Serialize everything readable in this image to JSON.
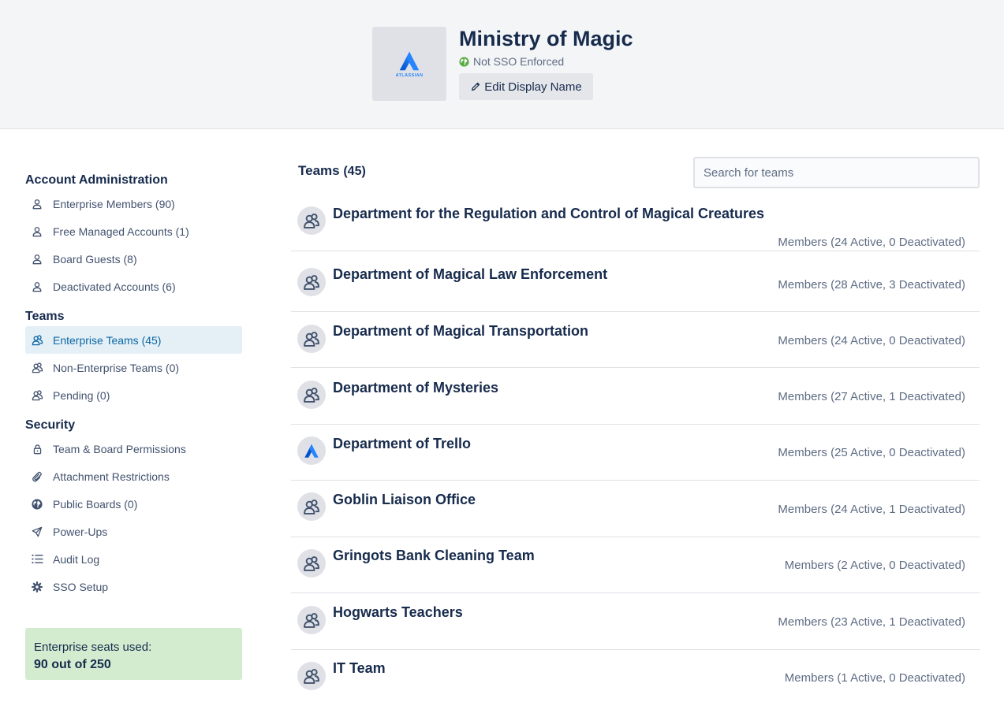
{
  "org": {
    "logo_wordmark": "ATLASSIAN",
    "name": "Ministry of Magic",
    "sso_status": "Not SSO Enforced",
    "edit_label": "Edit Display Name"
  },
  "sidebar": {
    "sections": [
      {
        "heading": "Account Administration",
        "items": [
          {
            "label": "Enterprise Members (90)",
            "icon": "person-icon"
          },
          {
            "label": "Free Managed Accounts (1)",
            "icon": "person-icon"
          },
          {
            "label": "Board Guests (8)",
            "icon": "person-icon"
          },
          {
            "label": "Deactivated Accounts (6)",
            "icon": "person-icon"
          }
        ]
      },
      {
        "heading": "Teams",
        "items": [
          {
            "label": "Enterprise Teams (45)",
            "icon": "team-icon",
            "active": true
          },
          {
            "label": "Non-Enterprise Teams (0)",
            "icon": "team-icon"
          },
          {
            "label": "Pending (0)",
            "icon": "team-icon"
          }
        ]
      },
      {
        "heading": "Security",
        "items": [
          {
            "label": "Team & Board Permissions",
            "icon": "lock-icon"
          },
          {
            "label": "Attachment Restrictions",
            "icon": "paperclip-icon"
          },
          {
            "label": "Public Boards (0)",
            "icon": "globe-icon"
          },
          {
            "label": "Power-Ups",
            "icon": "rocket-icon"
          },
          {
            "label": "Audit Log",
            "icon": "list-icon"
          },
          {
            "label": "SSO Setup",
            "icon": "gear-icon"
          }
        ]
      }
    ],
    "seats_label": "Enterprise seats used:",
    "seats_value": "90 out of 250"
  },
  "main": {
    "title": "Teams",
    "count": "(45)",
    "search_placeholder": "Search for teams",
    "teams": [
      {
        "name": "Department for the Regulation and Control of Magical Creatures",
        "members": "Members (24 Active, 0 Deactivated)",
        "avatar": "team-icon"
      },
      {
        "name": "Department of Magical Law Enforcement",
        "members": "Members (28 Active, 3 Deactivated)",
        "avatar": "team-icon"
      },
      {
        "name": "Department of Magical Transportation",
        "members": "Members (24 Active, 0 Deactivated)",
        "avatar": "team-icon"
      },
      {
        "name": "Department of Mysteries",
        "members": "Members (27 Active, 1 Deactivated)",
        "avatar": "team-icon"
      },
      {
        "name": "Department of Trello",
        "members": "Members (25 Active, 0 Deactivated)",
        "avatar": "atlassian-logo-icon"
      },
      {
        "name": "Goblin Liaison Office",
        "members": "Members (24 Active, 1 Deactivated)",
        "avatar": "team-icon"
      },
      {
        "name": "Gringots Bank Cleaning Team",
        "members": "Members (2 Active, 0 Deactivated)",
        "avatar": "team-icon"
      },
      {
        "name": "Hogwarts Teachers",
        "members": "Members (23 Active, 1 Deactivated)",
        "avatar": "team-icon"
      },
      {
        "name": "IT Team",
        "members": "Members (1 Active, 0 Deactivated)",
        "avatar": "team-icon"
      }
    ]
  }
}
